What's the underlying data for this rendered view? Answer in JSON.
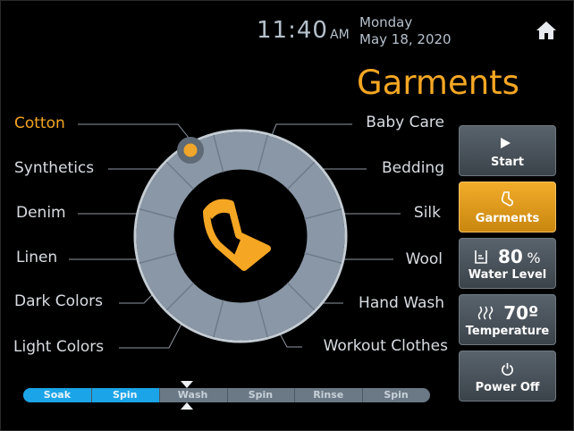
{
  "header": {
    "time": "11:40",
    "ampm": "AM",
    "day": "Monday",
    "date": "May 18, 2020",
    "home_icon": "home-icon"
  },
  "title": "Garments",
  "cycles": {
    "left": [
      "Cotton",
      "Synthetics",
      "Denim",
      "Linen",
      "Dark Colors",
      "Light Colors"
    ],
    "right": [
      "Baby Care",
      "Bedding",
      "Silk",
      "Wool",
      "Hand Wash",
      "Workout Clothes"
    ],
    "selected": "Cotton"
  },
  "center_icon": "sock-icon",
  "colors": {
    "accent": "#f5a623",
    "ring": "#8a97a7",
    "progress_fill": "#1ba5e8"
  },
  "buttons": {
    "start": {
      "icon": "play-icon",
      "label": "Start"
    },
    "garments": {
      "icon": "sock-icon",
      "label": "Garments"
    },
    "water": {
      "icon": "water-level-icon",
      "value": "80",
      "unit": "%",
      "label": "Water Level"
    },
    "temperature": {
      "icon": "heat-icon",
      "value": "70",
      "unit": "º",
      "label": "Temperature"
    },
    "power": {
      "icon": "power-icon",
      "label": "Power Off"
    }
  },
  "progress": {
    "steps": [
      "Soak",
      "Spin",
      "Wash",
      "Spin",
      "Rinse",
      "Spin"
    ],
    "completed": 2,
    "current": "Wash"
  }
}
